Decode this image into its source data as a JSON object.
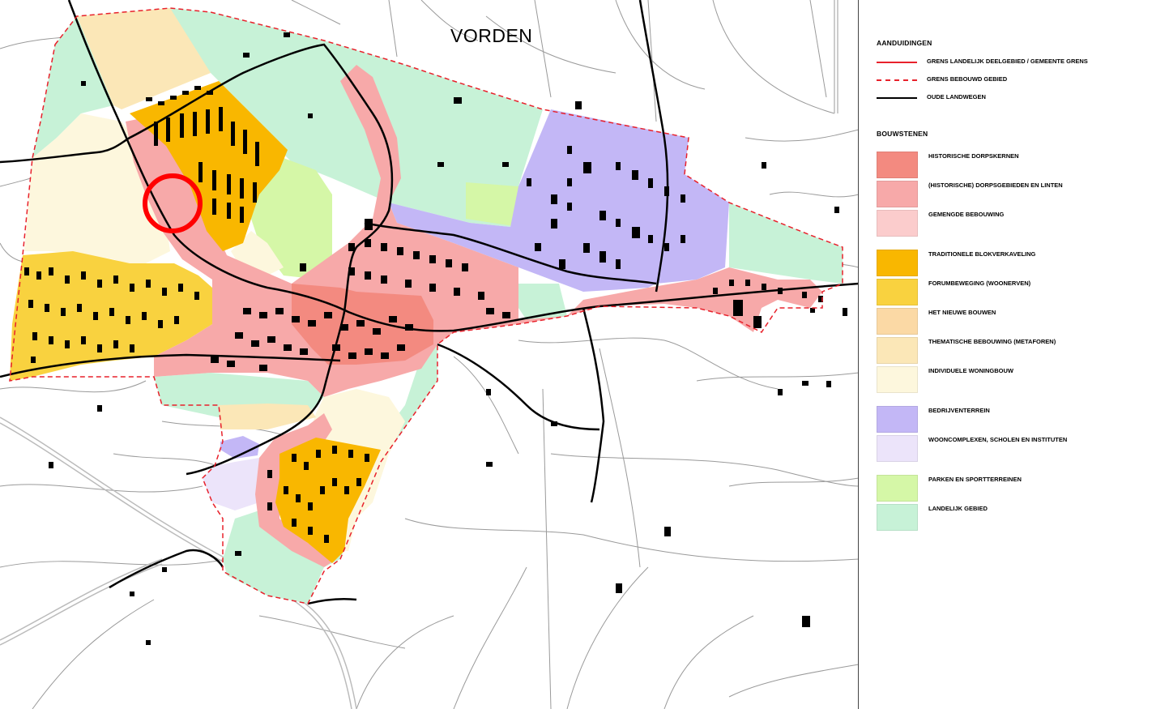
{
  "map": {
    "title": "VORDEN"
  },
  "legend": {
    "section1_title": "AANDUIDINGEN",
    "lines": [
      {
        "label": "GRENS LANDELIJK DEELGEBIED / GEMEENTE GRENS",
        "color": "#e8212b",
        "style": "solid"
      },
      {
        "label": "GRENS BEBOUWD GEBIED",
        "color": "#e8212b",
        "style": "dashed"
      },
      {
        "label": "OUDE LANDWEGEN",
        "color": "#000000",
        "style": "solid"
      }
    ],
    "section2_title": "BOUWSTENEN",
    "swatches": [
      {
        "label": "HISTORISCHE DORPSKERNEN",
        "color": "#f38a80"
      },
      {
        "label": "(HISTORISCHE) DORPSGEBIEDEN EN LINTEN",
        "color": "#f7a9a9"
      },
      {
        "label": "GEMENGDE BEBOUWING",
        "color": "#fbcccc"
      },
      {
        "label": "TRADITIONELE BLOKVERKAVELING",
        "color": "#f9b700"
      },
      {
        "label": "FORUMBEWEGING (WOONERVEN)",
        "color": "#f9d23f"
      },
      {
        "label": "HET NIEUWE BOUWEN",
        "color": "#fbd9a5"
      },
      {
        "label": "THEMATISCHE BEBOUWING (METAFOREN)",
        "color": "#fbe7b7"
      },
      {
        "label": "INDIVIDUELE WONINGBOUW",
        "color": "#fdf7dd"
      },
      {
        "label": "BEDRIJVENTERREIN",
        "color": "#c3b7f6"
      },
      {
        "label": "WOONCOMPLEXEN, SCHOLEN EN INSTITUTEN",
        "color": "#ece4fa"
      },
      {
        "label": "PARKEN EN SPORTTERREINEN",
        "color": "#d5f7a7"
      },
      {
        "label": "LANDELIJK GEBIED",
        "color": "#c7f2d7"
      }
    ]
  }
}
